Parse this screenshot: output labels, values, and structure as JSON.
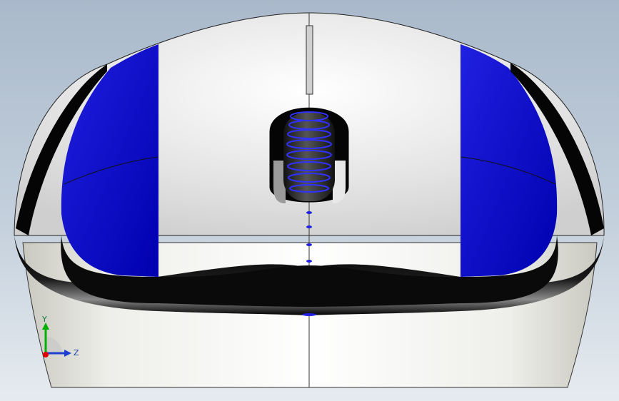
{
  "triad": {
    "y_label": "Y",
    "z_label": "Z"
  },
  "colors": {
    "body_white": "#eeeeee",
    "panel_blue": "#0000c8",
    "rim_black": "#060606",
    "background_top": "#a9b9cb",
    "background_bottom": "#e6ebf0",
    "axis_y": "#00b000",
    "axis_z": "#1f3fd0",
    "axis_x": "#e00000"
  },
  "model": {
    "icons": [
      "mouse-body",
      "left-blue-panel",
      "right-blue-panel",
      "scroll-wheel",
      "black-rim"
    ]
  }
}
